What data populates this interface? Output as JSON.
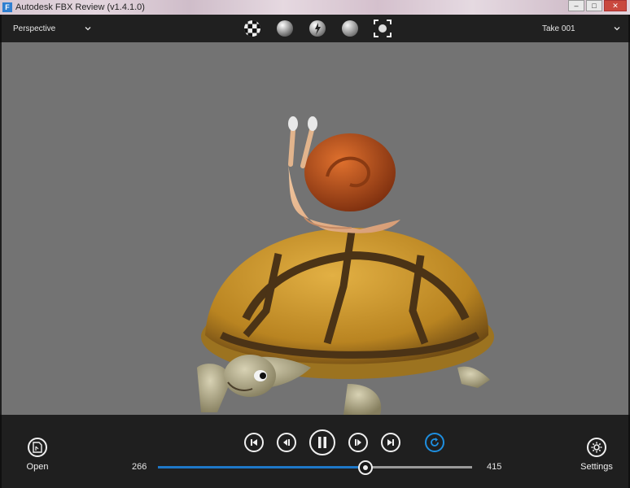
{
  "window": {
    "title": "Autodesk FBX Review (v1.4.1.0)",
    "icon_letter": "F"
  },
  "toolbar": {
    "view_select": {
      "selected": "Perspective"
    },
    "take_select": {
      "selected": "Take 001"
    },
    "shading_tools": [
      "checker-shading-icon",
      "smooth-shading-icon",
      "light-shading-icon",
      "sphere-shading-icon",
      "frame-all-icon"
    ]
  },
  "playback": {
    "open_label": "Open",
    "settings_label": "Settings",
    "start_frame": "266",
    "end_frame": "415",
    "progress": 0.66,
    "loop_color": "#1e8fe0",
    "accent_color": "#1e78c8"
  }
}
